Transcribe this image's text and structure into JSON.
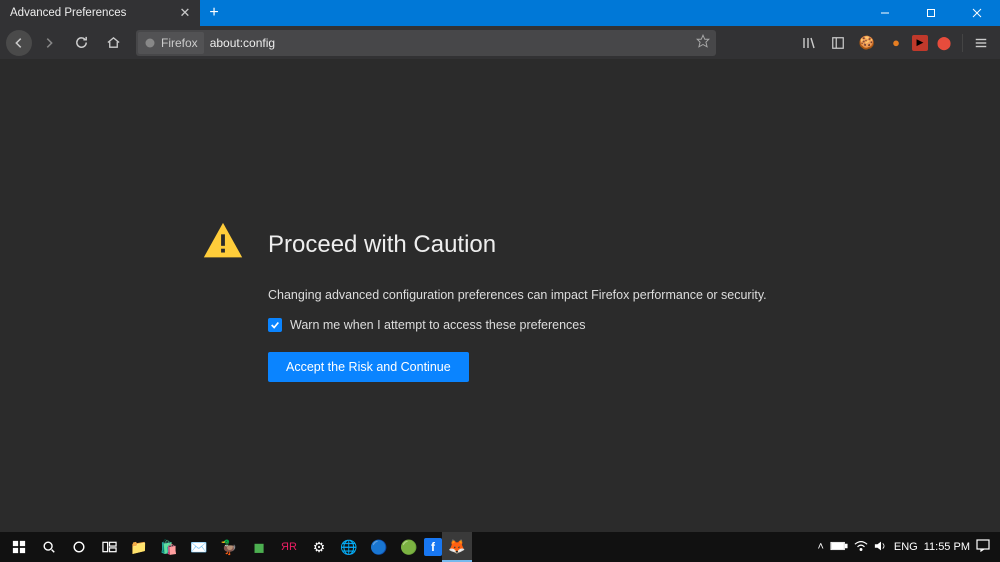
{
  "window": {
    "tab_title": "Advanced Preferences"
  },
  "navbar": {
    "identity_label": "Firefox",
    "url": "about:config"
  },
  "content": {
    "title": "Proceed with Caution",
    "description": "Changing advanced configuration preferences can impact Firefox performance or security.",
    "checkbox_label": "Warn me when I attempt to access these preferences",
    "checkbox_checked": true,
    "button_label": "Accept the Risk and Continue"
  },
  "taskbar": {
    "lang": "ENG",
    "time": "11:55 PM"
  }
}
